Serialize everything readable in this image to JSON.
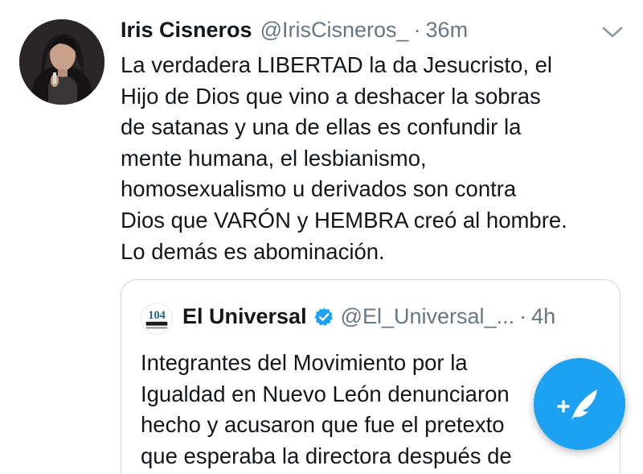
{
  "tweet": {
    "author_name": "Iris Cisneros",
    "author_handle": "@IrisCisneros_",
    "separator": "·",
    "time": "36m",
    "text_lines": [
      "La verdadera LIBERTAD la da Jesucristo, el",
      "Hijo de Dios que vino a deshacer la sobras",
      "de satanas y una de ellas es confundir la",
      "mente humana, el lesbianismo,",
      "homosexualismo u derivados son contra",
      "Dios que VARÓN y HEMBRA creó al hombre.",
      "Lo demás es abominación."
    ],
    "menu_icon": "chevron-down-icon"
  },
  "quoted_tweet": {
    "author_name": "El Universal",
    "verified_icon": "verified-badge-icon",
    "author_handle": "@El_Universal_...",
    "separator": "·",
    "time": "4h",
    "text_lines": [
      "Integrantes del Movimiento por la",
      "Igualdad en Nuevo León denunciaron",
      "hecho y acusaron que fue el pretexto",
      "que esperaba la directora después de"
    ]
  },
  "compose_button": {
    "icon": "compose-feather-icon"
  },
  "colors": {
    "text": "#14171a",
    "secondary": "#657786",
    "accent": "#1da1f2",
    "border": "#ccd6dd"
  }
}
